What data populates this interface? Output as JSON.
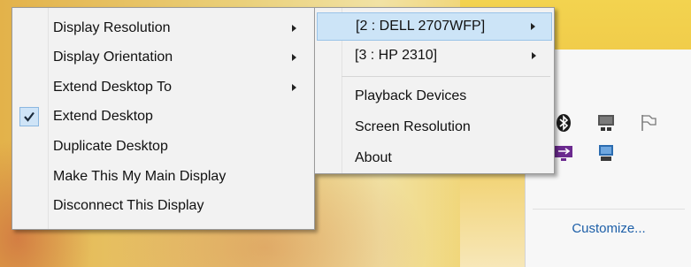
{
  "main_menu": {
    "items": [
      {
        "label": "Display Resolution",
        "submenu": true,
        "checked": false
      },
      {
        "label": "Display Orientation",
        "submenu": true,
        "checked": false
      },
      {
        "label": "Extend Desktop To",
        "submenu": true,
        "checked": false
      },
      {
        "label": "Extend Desktop",
        "submenu": false,
        "checked": true
      },
      {
        "label": "Duplicate Desktop",
        "submenu": false,
        "checked": false
      },
      {
        "label": "Make This My Main Display",
        "submenu": false,
        "checked": false
      },
      {
        "label": "Disconnect This Display",
        "submenu": false,
        "checked": false
      }
    ]
  },
  "sub_menu": {
    "items": [
      {
        "label": "[2 : DELL 2707WFP]",
        "submenu": true,
        "highlighted": true
      },
      {
        "label": "[3 : HP 2310]",
        "submenu": true,
        "highlighted": false
      },
      {
        "label": "Playback Devices",
        "submenu": false,
        "highlighted": false
      },
      {
        "label": "Screen Resolution",
        "submenu": false,
        "highlighted": false
      },
      {
        "label": "About",
        "submenu": false,
        "highlighted": false
      }
    ]
  },
  "tray": {
    "icons": [
      "bluetooth-icon",
      "display-icon",
      "action-center-flag-icon",
      "usb-display-icon",
      "network-display-icon"
    ],
    "customize_label": "Customize..."
  },
  "colors": {
    "menu_bg": "#f2f2f2",
    "highlight": "#cce4f7",
    "link": "#1d5fa8"
  }
}
